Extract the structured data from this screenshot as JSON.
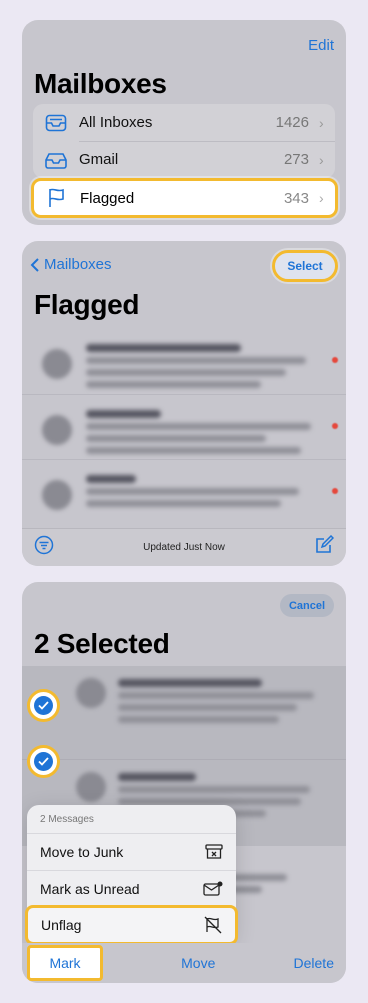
{
  "panel1": {
    "edit_label": "Edit",
    "title": "Mailboxes",
    "mailboxes": [
      {
        "label": "All Inboxes",
        "count": "1426",
        "icon": "inbox-tray-icon"
      },
      {
        "label": "Gmail",
        "count": "273",
        "icon": "inbox-tray-icon"
      }
    ],
    "flagged": {
      "label": "Flagged",
      "count": "343",
      "icon": "flag-icon"
    }
  },
  "panel2": {
    "back_label": "Mailboxes",
    "select_label": "Select",
    "title": "Flagged",
    "status": "Updated Just Now"
  },
  "panel3": {
    "cancel_label": "Cancel",
    "title": "2 Selected",
    "menu": {
      "header": "2 Messages",
      "items": [
        "Move to Junk",
        "Mark as Unread",
        "Unflag"
      ]
    },
    "toolbar": {
      "mark": "Mark",
      "move": "Move",
      "delete": "Delete"
    }
  },
  "colors": {
    "accent": "#1f74d6",
    "highlight": "#f3ba2f",
    "unread_dot": "#e5483c"
  }
}
